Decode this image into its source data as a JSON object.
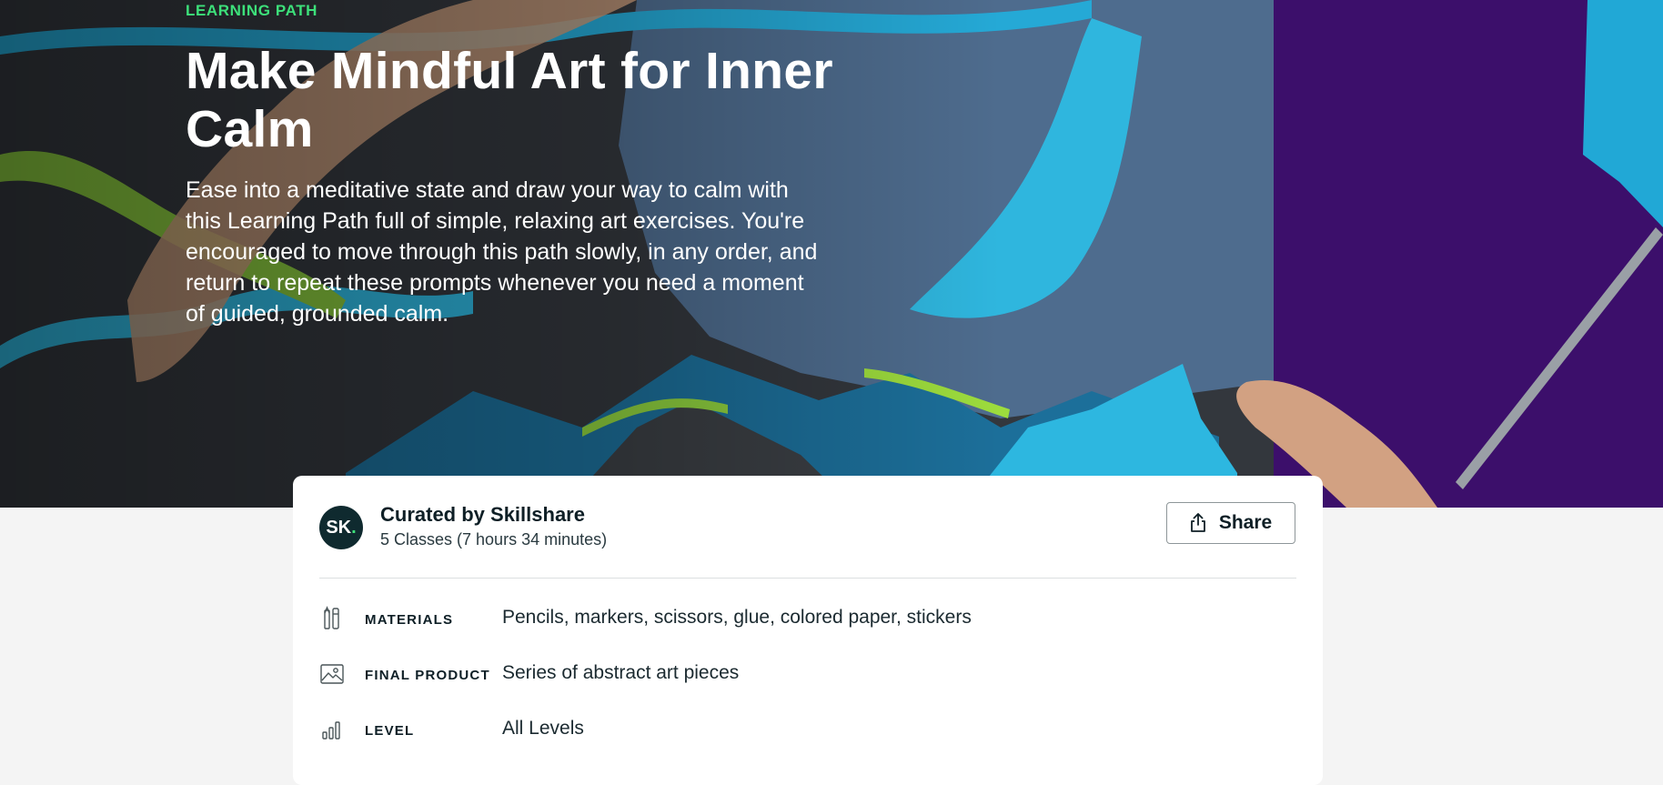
{
  "hero": {
    "eyebrow": "LEARNING PATH",
    "title": "Make Mindful Art for Inner Calm",
    "description": "Ease into a meditative state and draw your way to calm with this Learning Path full of simple, relaxing art exercises. You're encouraged to move through this path slowly, in any order, and return to repeat these prompts whenever you need a moment of guided, grounded calm."
  },
  "card": {
    "avatar": {
      "initials": "SK",
      "dot": "."
    },
    "curator": "Curated by Skillshare",
    "meta": "5 Classes (7 hours 34 minutes)",
    "share_label": "Share",
    "details": [
      {
        "icon": "pencils-icon",
        "label": "MATERIALS",
        "value": "Pencils, markers, scissors, glue, colored paper, stickers"
      },
      {
        "icon": "image-icon",
        "label": "FINAL PRODUCT",
        "value": "Series of abstract art pieces"
      },
      {
        "icon": "bars-icon",
        "label": "LEVEL",
        "value": "All Levels"
      }
    ]
  },
  "colors": {
    "accent": "#3de07a",
    "avatar_bg": "#0f2a2f",
    "text_dark": "#0e1f26",
    "page_bg": "#f4f4f4"
  }
}
